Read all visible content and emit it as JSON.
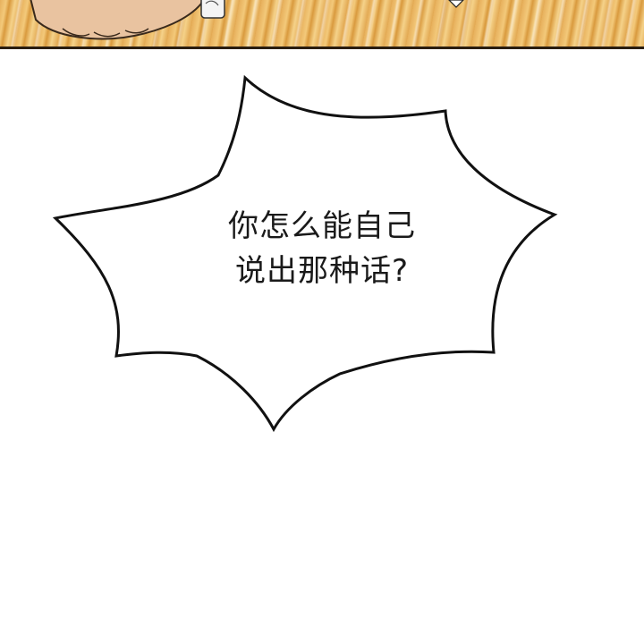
{
  "speech_bubble": {
    "line1": "你怎么能自己",
    "line2": "说出那种话?"
  },
  "colors": {
    "floor": "#e7b05c",
    "panel_border": "#2a1d10",
    "bubble_fill": "#ffffff",
    "bubble_stroke": "#111111",
    "text": "#1a1a1a"
  }
}
